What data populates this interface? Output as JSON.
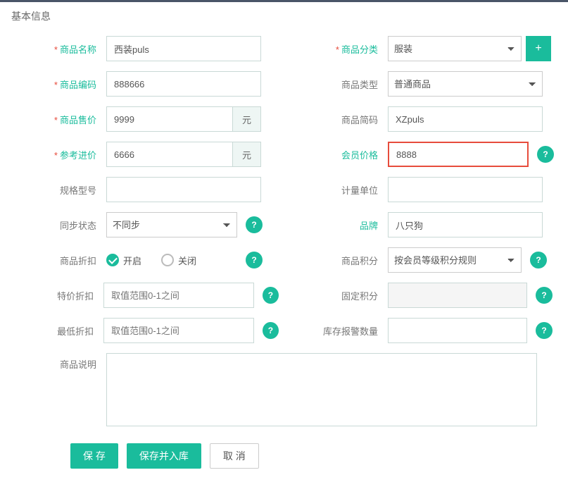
{
  "section_title": "基本信息",
  "labels": {
    "product_name": "商品名称",
    "product_code": "商品编码",
    "sale_price": "商品售价",
    "ref_price": "参考进价",
    "spec": "规格型号",
    "sync_status": "同步状态",
    "discount": "商品折扣",
    "special_discount": "特价折扣",
    "min_discount": "最低折扣",
    "desc": "商品说明",
    "category": "商品分类",
    "type": "商品类型",
    "short_code": "商品简码",
    "member_price": "会员价格",
    "unit": "计量单位",
    "brand": "品牌",
    "points": "商品积分",
    "fixed_points": "固定积分",
    "stock_alert": "库存报警数量"
  },
  "values": {
    "product_name": "西装puls",
    "product_code": "888666",
    "sale_price": "9999",
    "ref_price": "6666",
    "short_code": "XZpuls",
    "member_price": "8888",
    "brand": "八只狗"
  },
  "selects": {
    "category": "服装",
    "type": "普通商品",
    "sync_status": "不同步",
    "points": "按会员等级积分规则"
  },
  "placeholders": {
    "special_discount": "取值范围0-1之间",
    "min_discount": "取值范围0-1之间"
  },
  "units": {
    "yuan": "元"
  },
  "radio": {
    "on": "开启",
    "off": "关闭"
  },
  "help": "?",
  "buttons": {
    "save": "保 存",
    "save_stock": "保存并入库",
    "cancel": "取 消",
    "plus": "+"
  }
}
